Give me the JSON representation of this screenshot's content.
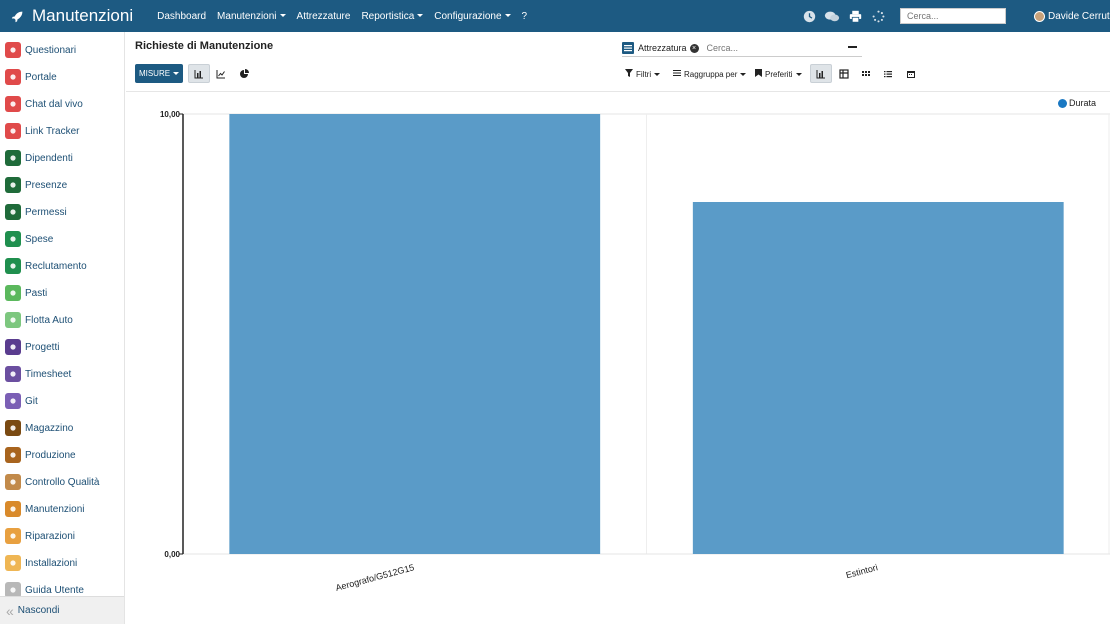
{
  "app": {
    "title": "Manutenzioni",
    "icon": "rocket-icon"
  },
  "topnav": {
    "items": [
      {
        "label": "Dashboard",
        "dropdown": false
      },
      {
        "label": "Manutenzioni",
        "dropdown": true
      },
      {
        "label": "Attrezzature",
        "dropdown": false
      },
      {
        "label": "Reportistica",
        "dropdown": true
      },
      {
        "label": "Configurazione",
        "dropdown": true
      },
      {
        "label": "?",
        "dropdown": false
      }
    ]
  },
  "topbar": {
    "icons": [
      "clock-icon",
      "chat-icon",
      "printer-icon",
      "spinner-icon"
    ],
    "search_placeholder": "Cerca...",
    "user": "Davide Cerruti"
  },
  "sidebar": {
    "items": [
      {
        "label": "Questionari",
        "icon": "clipboard-icon",
        "color": "#e04a4a"
      },
      {
        "label": "Portale",
        "icon": "globe-icon",
        "color": "#e04a4a"
      },
      {
        "label": "Chat dal vivo",
        "icon": "chat-bubbles-icon",
        "color": "#e04a4a"
      },
      {
        "label": "Link Tracker",
        "icon": "link-icon",
        "color": "#e04a4a"
      },
      {
        "label": "Dipendenti",
        "icon": "users-icon",
        "color": "#1f6b3a"
      },
      {
        "label": "Presenze",
        "icon": "user-check-icon",
        "color": "#1f6b3a"
      },
      {
        "label": "Permessi",
        "icon": "calendar-leave-icon",
        "color": "#1f6b3a"
      },
      {
        "label": "Spese",
        "icon": "dollar-icon",
        "color": "#1f8f4e"
      },
      {
        "label": "Reclutamento",
        "icon": "search-user-icon",
        "color": "#1f8f4e"
      },
      {
        "label": "Pasti",
        "icon": "cutlery-icon",
        "color": "#5bb85d"
      },
      {
        "label": "Flotta Auto",
        "icon": "car-icon",
        "color": "#7dc77f"
      },
      {
        "label": "Progetti",
        "icon": "puzzle-icon",
        "color": "#5a3c8f"
      },
      {
        "label": "Timesheet",
        "icon": "clock-icon",
        "color": "#6b4fa0"
      },
      {
        "label": "Git",
        "icon": "git-icon",
        "color": "#7b5fb5"
      },
      {
        "label": "Magazzino",
        "icon": "box-icon",
        "color": "#7a4a12"
      },
      {
        "label": "Produzione",
        "icon": "wrench-icon",
        "color": "#a8641e"
      },
      {
        "label": "Controllo Qualità",
        "icon": "award-icon",
        "color": "#c28a4a"
      },
      {
        "label": "Manutenzioni",
        "icon": "hammer-icon",
        "color": "#d98a2b"
      },
      {
        "label": "Riparazioni",
        "icon": "screwdriver-icon",
        "color": "#e8a040"
      },
      {
        "label": "Installazioni",
        "icon": "list-icon",
        "color": "#efb654"
      },
      {
        "label": "Guida Utente",
        "icon": "book-icon",
        "color": "#b8b8b8"
      }
    ],
    "hide_label": "Nascondi"
  },
  "page": {
    "title": "Richieste di Manutenzione",
    "facet": {
      "label": "Attrezzatura",
      "icon": "list-icon"
    },
    "search_placeholder": "Cerca..."
  },
  "controls": {
    "measures_label": "MISURE",
    "filters_label": "Filtri",
    "groupby_label": "Raggruppa per",
    "favorites_label": "Preferiti"
  },
  "chart_data": {
    "type": "bar",
    "categories": [
      "Aerografo/G512G15",
      "Estintori"
    ],
    "series": [
      {
        "name": "Durata",
        "values": [
          10.0,
          8.0
        ]
      }
    ],
    "ylim": [
      0,
      10
    ],
    "ytick_labels": [
      "0,00",
      "10,00"
    ],
    "legend": "top-right",
    "grid": true,
    "color": "#5a9bc8"
  }
}
